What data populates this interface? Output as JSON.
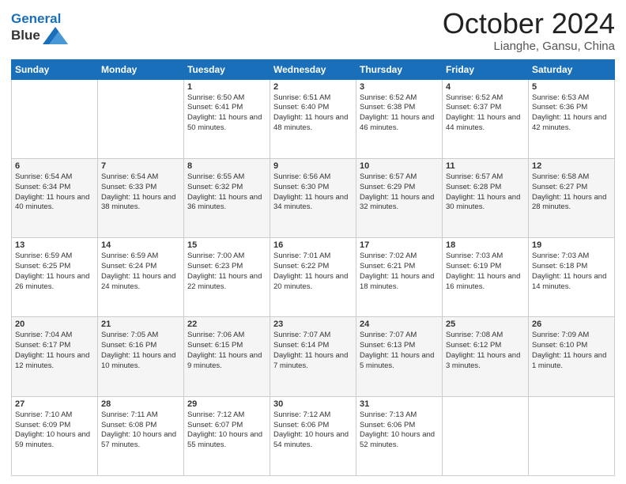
{
  "header": {
    "logo_line1": "General",
    "logo_line2": "Blue",
    "month": "October 2024",
    "location": "Lianghe, Gansu, China"
  },
  "days_of_week": [
    "Sunday",
    "Monday",
    "Tuesday",
    "Wednesday",
    "Thursday",
    "Friday",
    "Saturday"
  ],
  "weeks": [
    [
      {
        "day": "",
        "info": ""
      },
      {
        "day": "",
        "info": ""
      },
      {
        "day": "1",
        "info": "Sunrise: 6:50 AM\nSunset: 6:41 PM\nDaylight: 11 hours and 50 minutes."
      },
      {
        "day": "2",
        "info": "Sunrise: 6:51 AM\nSunset: 6:40 PM\nDaylight: 11 hours and 48 minutes."
      },
      {
        "day": "3",
        "info": "Sunrise: 6:52 AM\nSunset: 6:38 PM\nDaylight: 11 hours and 46 minutes."
      },
      {
        "day": "4",
        "info": "Sunrise: 6:52 AM\nSunset: 6:37 PM\nDaylight: 11 hours and 44 minutes."
      },
      {
        "day": "5",
        "info": "Sunrise: 6:53 AM\nSunset: 6:36 PM\nDaylight: 11 hours and 42 minutes."
      }
    ],
    [
      {
        "day": "6",
        "info": "Sunrise: 6:54 AM\nSunset: 6:34 PM\nDaylight: 11 hours and 40 minutes."
      },
      {
        "day": "7",
        "info": "Sunrise: 6:54 AM\nSunset: 6:33 PM\nDaylight: 11 hours and 38 minutes."
      },
      {
        "day": "8",
        "info": "Sunrise: 6:55 AM\nSunset: 6:32 PM\nDaylight: 11 hours and 36 minutes."
      },
      {
        "day": "9",
        "info": "Sunrise: 6:56 AM\nSunset: 6:30 PM\nDaylight: 11 hours and 34 minutes."
      },
      {
        "day": "10",
        "info": "Sunrise: 6:57 AM\nSunset: 6:29 PM\nDaylight: 11 hours and 32 minutes."
      },
      {
        "day": "11",
        "info": "Sunrise: 6:57 AM\nSunset: 6:28 PM\nDaylight: 11 hours and 30 minutes."
      },
      {
        "day": "12",
        "info": "Sunrise: 6:58 AM\nSunset: 6:27 PM\nDaylight: 11 hours and 28 minutes."
      }
    ],
    [
      {
        "day": "13",
        "info": "Sunrise: 6:59 AM\nSunset: 6:25 PM\nDaylight: 11 hours and 26 minutes."
      },
      {
        "day": "14",
        "info": "Sunrise: 6:59 AM\nSunset: 6:24 PM\nDaylight: 11 hours and 24 minutes."
      },
      {
        "day": "15",
        "info": "Sunrise: 7:00 AM\nSunset: 6:23 PM\nDaylight: 11 hours and 22 minutes."
      },
      {
        "day": "16",
        "info": "Sunrise: 7:01 AM\nSunset: 6:22 PM\nDaylight: 11 hours and 20 minutes."
      },
      {
        "day": "17",
        "info": "Sunrise: 7:02 AM\nSunset: 6:21 PM\nDaylight: 11 hours and 18 minutes."
      },
      {
        "day": "18",
        "info": "Sunrise: 7:03 AM\nSunset: 6:19 PM\nDaylight: 11 hours and 16 minutes."
      },
      {
        "day": "19",
        "info": "Sunrise: 7:03 AM\nSunset: 6:18 PM\nDaylight: 11 hours and 14 minutes."
      }
    ],
    [
      {
        "day": "20",
        "info": "Sunrise: 7:04 AM\nSunset: 6:17 PM\nDaylight: 11 hours and 12 minutes."
      },
      {
        "day": "21",
        "info": "Sunrise: 7:05 AM\nSunset: 6:16 PM\nDaylight: 11 hours and 10 minutes."
      },
      {
        "day": "22",
        "info": "Sunrise: 7:06 AM\nSunset: 6:15 PM\nDaylight: 11 hours and 9 minutes."
      },
      {
        "day": "23",
        "info": "Sunrise: 7:07 AM\nSunset: 6:14 PM\nDaylight: 11 hours and 7 minutes."
      },
      {
        "day": "24",
        "info": "Sunrise: 7:07 AM\nSunset: 6:13 PM\nDaylight: 11 hours and 5 minutes."
      },
      {
        "day": "25",
        "info": "Sunrise: 7:08 AM\nSunset: 6:12 PM\nDaylight: 11 hours and 3 minutes."
      },
      {
        "day": "26",
        "info": "Sunrise: 7:09 AM\nSunset: 6:10 PM\nDaylight: 11 hours and 1 minute."
      }
    ],
    [
      {
        "day": "27",
        "info": "Sunrise: 7:10 AM\nSunset: 6:09 PM\nDaylight: 10 hours and 59 minutes."
      },
      {
        "day": "28",
        "info": "Sunrise: 7:11 AM\nSunset: 6:08 PM\nDaylight: 10 hours and 57 minutes."
      },
      {
        "day": "29",
        "info": "Sunrise: 7:12 AM\nSunset: 6:07 PM\nDaylight: 10 hours and 55 minutes."
      },
      {
        "day": "30",
        "info": "Sunrise: 7:12 AM\nSunset: 6:06 PM\nDaylight: 10 hours and 54 minutes."
      },
      {
        "day": "31",
        "info": "Sunrise: 7:13 AM\nSunset: 6:06 PM\nDaylight: 10 hours and 52 minutes."
      },
      {
        "day": "",
        "info": ""
      },
      {
        "day": "",
        "info": ""
      }
    ]
  ]
}
